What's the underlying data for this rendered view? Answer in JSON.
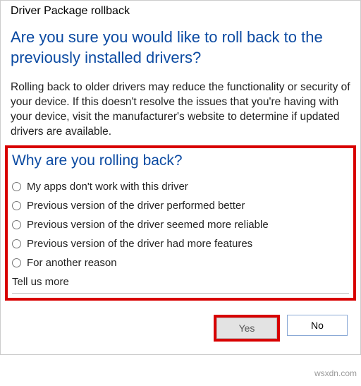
{
  "window": {
    "title": "Driver Package rollback"
  },
  "headline": "Are you sure you would like to roll back to the previously installed drivers?",
  "body": "Rolling back to older drivers may reduce the functionality or security of your device. If this doesn't resolve the issues that you're having with your device, visit the manufacturer's website to determine if updated drivers are available.",
  "reason": {
    "heading": "Why are you rolling back?",
    "options": [
      "My apps don't work with this driver",
      "Previous version of the driver performed better",
      "Previous version of the driver seemed more reliable",
      "Previous version of the driver had more features",
      "For another reason"
    ],
    "tell_us_more": "Tell us more"
  },
  "buttons": {
    "yes": "Yes",
    "no": "No"
  },
  "watermark": "wsxdn.com"
}
